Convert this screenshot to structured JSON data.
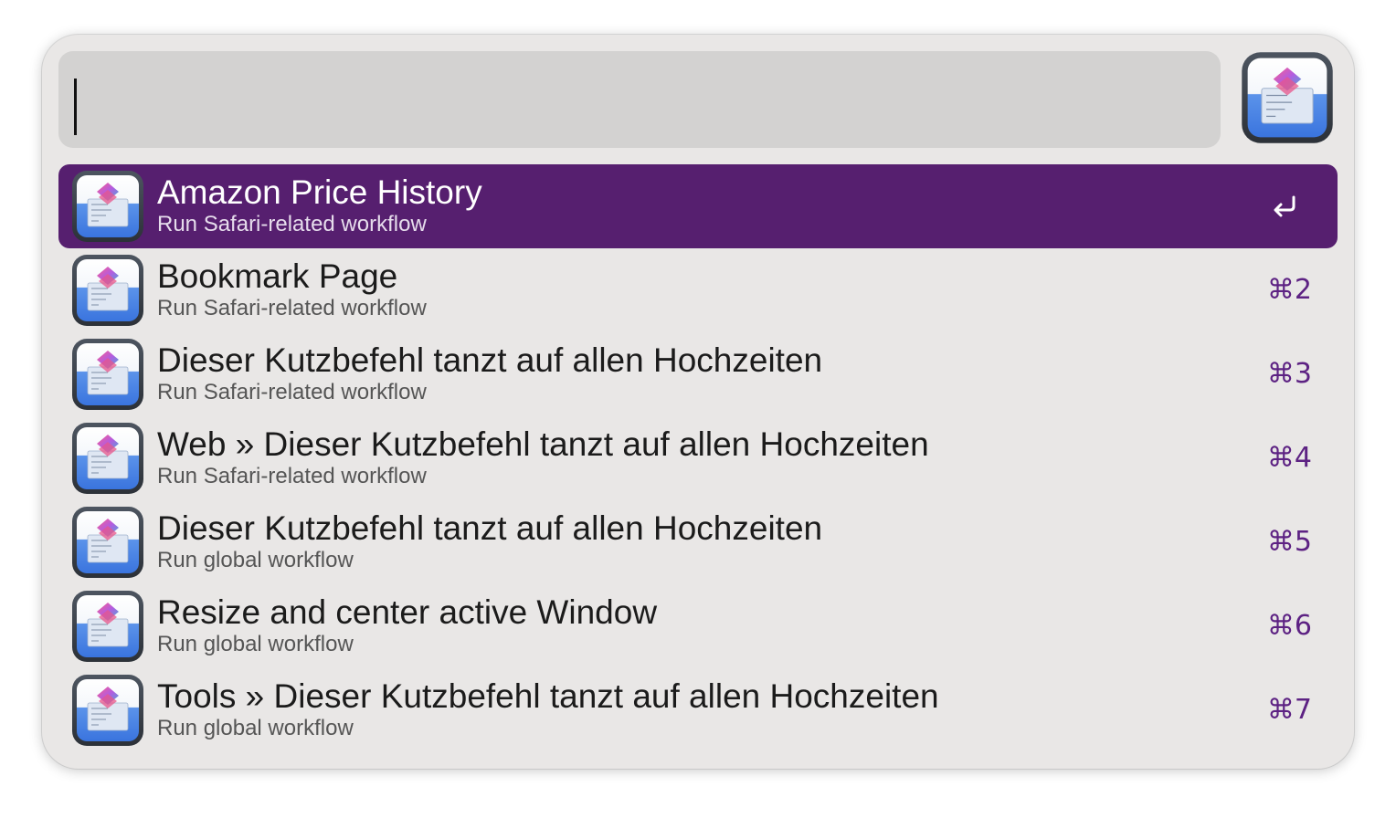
{
  "search": {
    "query": ""
  },
  "results": [
    {
      "title": "Amazon Price History",
      "subtitle": "Run Safari-related workflow",
      "shortcut": "",
      "selected": true,
      "icon": "shortcuts-workflow-icon"
    },
    {
      "title": "Bookmark Page",
      "subtitle": "Run Safari-related workflow",
      "shortcut": "⌘2",
      "selected": false,
      "icon": "shortcuts-workflow-icon"
    },
    {
      "title": "Dieser Kutzbefehl tanzt auf allen Hochzeiten",
      "subtitle": "Run Safari-related workflow",
      "shortcut": "⌘3",
      "selected": false,
      "icon": "shortcuts-workflow-icon"
    },
    {
      "title": "Web » Dieser Kutzbefehl tanzt auf allen Hochzeiten",
      "subtitle": "Run Safari-related workflow",
      "shortcut": "⌘4",
      "selected": false,
      "icon": "shortcuts-workflow-icon"
    },
    {
      "title": "Dieser Kutzbefehl tanzt auf allen Hochzeiten",
      "subtitle": "Run global workflow",
      "shortcut": "⌘5",
      "selected": false,
      "icon": "shortcuts-workflow-icon"
    },
    {
      "title": "Resize and center active Window",
      "subtitle": "Run global workflow",
      "shortcut": "⌘6",
      "selected": false,
      "icon": "shortcuts-workflow-icon"
    },
    {
      "title": "Tools » Dieser Kutzbefehl tanzt auf allen Hochzeiten",
      "subtitle": "Run global workflow",
      "shortcut": "⌘7",
      "selected": false,
      "icon": "shortcuts-workflow-icon"
    }
  ],
  "colors": {
    "selection": "#561f6f",
    "shortcut": "#5d2283",
    "window_bg": "#e9e7e6",
    "search_bg": "#d3d2d1"
  }
}
